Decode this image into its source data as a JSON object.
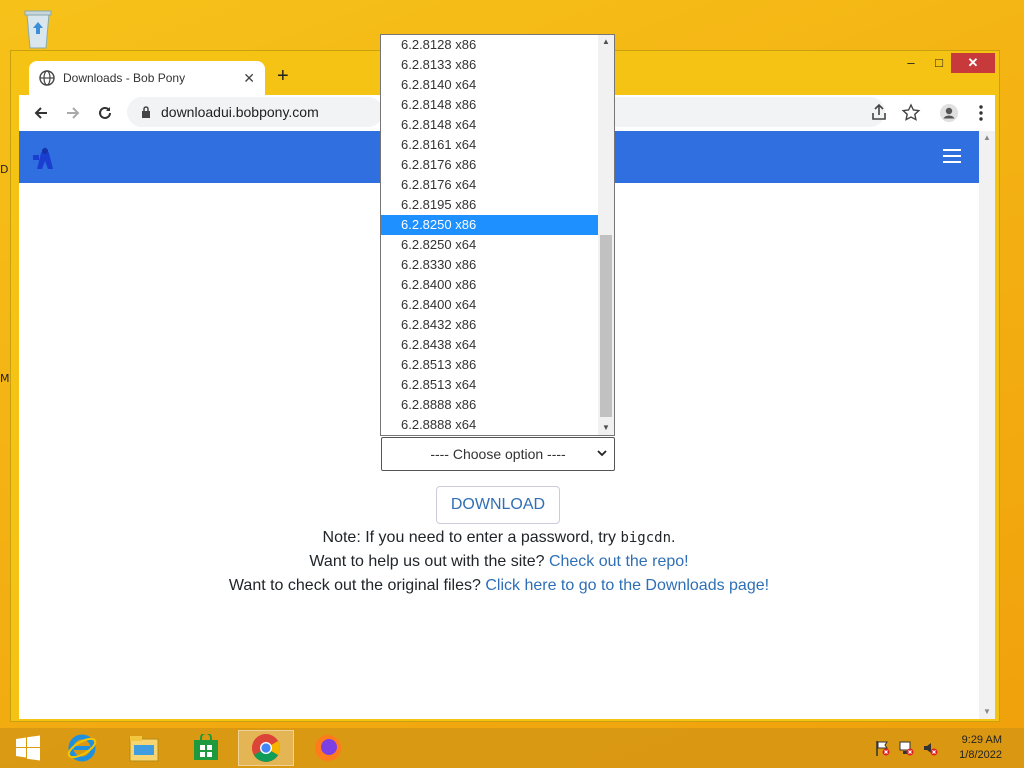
{
  "browser": {
    "tab_title": "Downloads - Bob Pony",
    "url": "downloadui.bobpony.com",
    "new_tab_symbol": "+",
    "minimize_symbol": "–",
    "maximize_symbol": "□",
    "close_symbol": "✕"
  },
  "page": {
    "select_placeholder": "---- Choose option ----",
    "download_label": "DOWNLOAD",
    "note_prefix": "Note: If you need to enter a password, try ",
    "note_code": "bigcdn",
    "note_suffix": ".",
    "help_text": "Want to help us out with the site? ",
    "help_link": "Check out the repo!",
    "original_text": "Want to check out the original files? ",
    "original_link": "Click here to go to the Downloads page!"
  },
  "dropdown": {
    "selected_index": 9,
    "options": [
      "6.2.8128 x86",
      "6.2.8133 x86",
      "6.2.8140 x64",
      "6.2.8148 x86",
      "6.2.8148 x64",
      "6.2.8161 x64",
      "6.2.8176 x86",
      "6.2.8176 x64",
      "6.2.8195 x86",
      "6.2.8250 x86",
      "6.2.8250 x64",
      "6.2.8330 x86",
      "6.2.8400 x86",
      "6.2.8400 x64",
      "6.2.8432 x86",
      "6.2.8438 x64",
      "6.2.8513 x86",
      "6.2.8513 x64",
      "6.2.8888 x86",
      "6.2.8888 x64"
    ]
  },
  "taskbar": {
    "time": "9:29 AM",
    "date": "1/8/2022",
    "apps": [
      "internet-explorer",
      "file-explorer",
      "store",
      "chrome",
      "firefox"
    ]
  },
  "desktop": {
    "edge_letters": [
      "D",
      "M"
    ]
  },
  "colors": {
    "navbar": "#2f6fe0",
    "link": "#2f6fb5",
    "selection": "#1e90ff",
    "close_button": "#c7393a"
  }
}
